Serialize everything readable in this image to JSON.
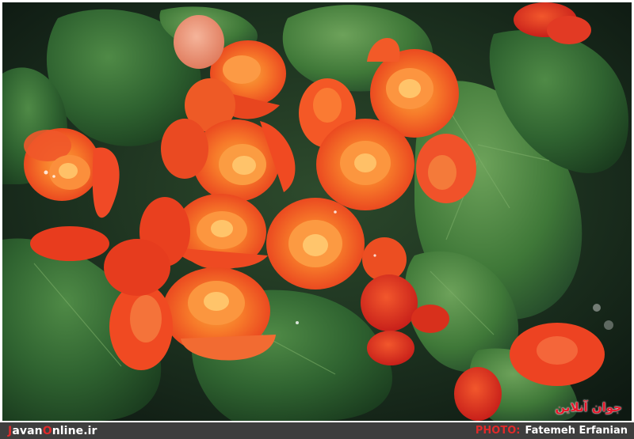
{
  "photo": {
    "subject": "orange-begonia-flowers",
    "watermark": "جوان آنلاین"
  },
  "footer": {
    "site_first_letter": "J",
    "site_mid": "avan",
    "site_accent_o": "O",
    "site_rest": "nline.ir",
    "credit_label": "PHOTO:",
    "credit_name": "Fatemeh Erfanian",
    "background": "#3e3e3e",
    "accent_color": "#e02a2a"
  }
}
